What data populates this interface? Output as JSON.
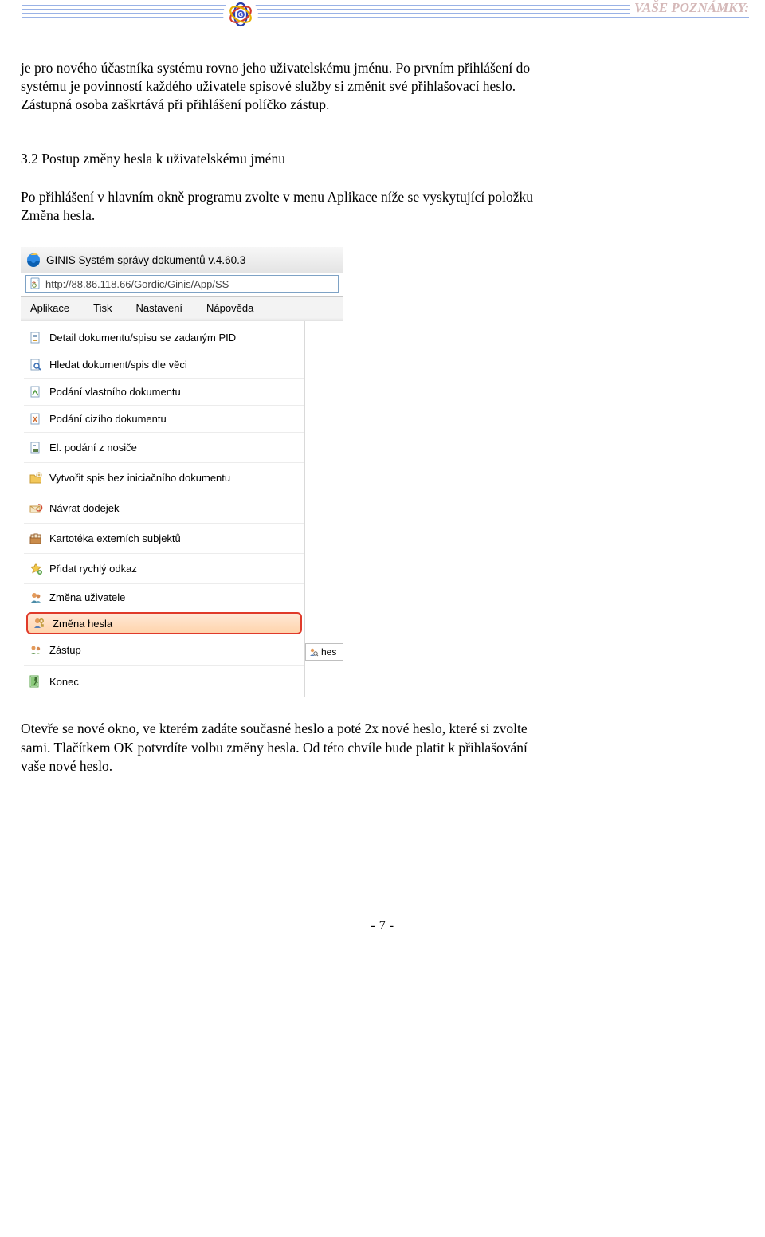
{
  "header": {
    "notes_label": "VAŠE POZNÁMKY:"
  },
  "body": {
    "para1": "je pro nového účastníka systému rovno jeho uživatelskému jménu. Po prvním přihlášení do systému je povinností každého uživatele spisové služby si změnit své přihlašovací heslo. Zástupná osoba zaškrtává při přihlášení políčko zástup.",
    "subheading": "3.2 Postup změny hesla k uživatelskému jménu",
    "para2": "Po přihlášení v hlavním okně programu zvolte v menu Aplikace níže se vyskytující položku Změna hesla.",
    "para3": "Otevře se nové okno, ve kterém zadáte současné heslo a poté 2x nové heslo, které si zvolte sami. Tlačítkem OK potvrdíte volbu změny hesla. Od této chvíle bude platit k přihlašování vaše nové heslo."
  },
  "screenshot": {
    "window_title": "GINIS Systém správy dokumentů v.4.60.3",
    "address": "http://88.86.118.66/Gordic/Ginis/App/SS",
    "menubar": [
      "Aplikace",
      "Tisk",
      "Nastavení",
      "Nápověda"
    ],
    "items": [
      {
        "icon": "page-pid",
        "label": "Detail dokumentu/spisu se zadaným PID"
      },
      {
        "icon": "page-search",
        "label": "Hledat dokument/spis dle věci"
      },
      {
        "icon": "page-own",
        "label": "Podání vlastního dokumentu"
      },
      {
        "icon": "page-foreign",
        "label": "Podání cizího dokumentu"
      },
      {
        "icon": "page-el",
        "label": "El. podání z nosiče"
      },
      {
        "icon": "folder-new",
        "label": "Vytvořit spis bez iniciačního dokumentu"
      },
      {
        "icon": "return",
        "label": "Návrat dodejek"
      },
      {
        "icon": "card-ext",
        "label": "Kartotéka externích subjektů"
      },
      {
        "icon": "fav-add",
        "label": "Přidat rychlý odkaz"
      },
      {
        "icon": "user-change",
        "label": "Změna uživatele"
      },
      {
        "icon": "key",
        "label": "Změna hesla",
        "highlight": true
      },
      {
        "icon": "users",
        "label": "Zástup"
      },
      {
        "icon": "exit",
        "label": "Konec"
      }
    ],
    "side_field": "hes"
  },
  "footer": {
    "page": "- 7 -"
  }
}
